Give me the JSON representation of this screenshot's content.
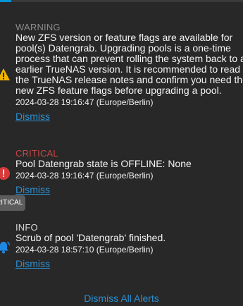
{
  "alerts": [
    {
      "level": "WARNING",
      "icon": "warning-triangle-icon",
      "message_lines": [
        "New ZFS version or feature flags are available for",
        "pool(s) Datengrab. Upgrading pools is a one-time",
        "process that can prevent rolling the system back to an",
        "earlier TrueNAS version. It is recommended to read",
        "the TrueNAS release notes and confirm you need the",
        "new ZFS feature flags before upgrading a pool."
      ],
      "timestamp": "2024-03-28 19:16:47 (Europe/Berlin)",
      "dismiss_label": "Dismiss"
    },
    {
      "level": "CRITICAL",
      "icon": "error-circle-icon",
      "message_lines": [
        "Pool Datengrab state is OFFLINE: None"
      ],
      "timestamp": "2024-03-28 19:16:47 (Europe/Berlin)",
      "dismiss_label": "Dismiss"
    },
    {
      "level": "INFO",
      "icon": "bell-icon",
      "message_lines": [
        "Scrub of pool 'Datengrab' finished."
      ],
      "timestamp": "2024-03-28 18:57:10 (Europe/Berlin)",
      "dismiss_label": "Dismiss"
    }
  ],
  "tooltip": {
    "text": "RITICAL"
  },
  "footer": {
    "dismiss_all_label": "Dismiss All Alerts"
  },
  "colors": {
    "background": "#282828",
    "link": "#2c8fd0",
    "warning_icon": "#f0b400",
    "critical": "#c94745",
    "info_icon": "#1e88e5"
  }
}
